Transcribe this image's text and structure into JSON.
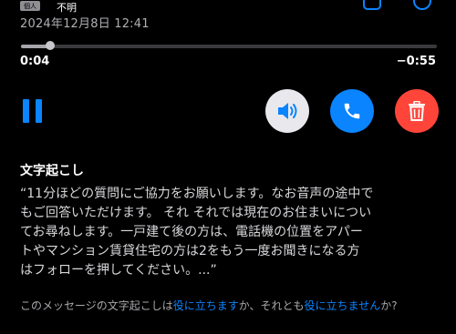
{
  "header": {
    "badge": "個人",
    "caller": "不明",
    "datetime": "2024年12月8日 12:41"
  },
  "player": {
    "elapsed": "0:04",
    "remaining": "−0:55",
    "progress_fraction": 0.07
  },
  "controls": {
    "pause_icon": "pause-icon",
    "speaker_icon": "speaker-icon",
    "call_icon": "phone-icon",
    "delete_icon": "trash-icon"
  },
  "transcript": {
    "title": "文字起こし",
    "text": "“11分ほどの質問にご協力をお願いします。なお音声の途中で\n  もご回答いただけます。 それ それでは現在のお住まいについ\n  てお尋ねします。一戸建て後の方は、電話機の位置をアパー\n  トやマンション賃貸住宅の方は2をもう一度お聞きになる方\n  はフォローを押してください。...”"
  },
  "feedback": {
    "prefix": "このメッセージの文字起こしは",
    "useful_link": "役に立ちます",
    "middle": "か、それとも",
    "not_useful_link": "役に立ちません",
    "suffix": "か?"
  },
  "colors": {
    "accent": "#0a84ff",
    "delete": "#ff453a",
    "speaker_bg": "#e8e8ed",
    "background": "#000000"
  }
}
